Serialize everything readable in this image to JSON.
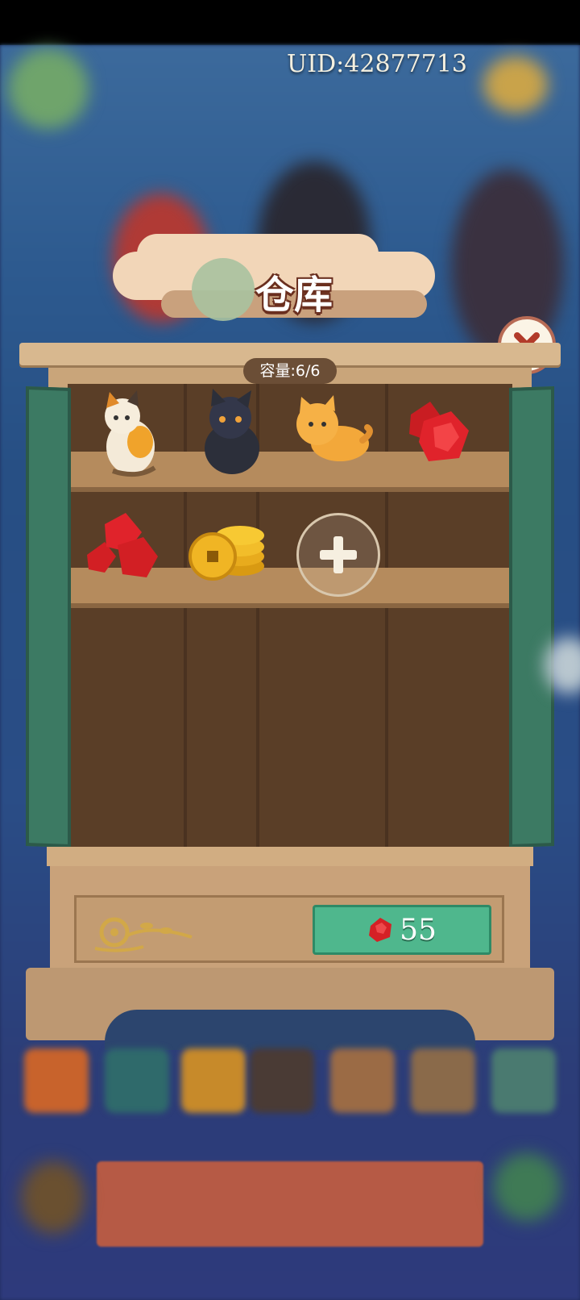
{
  "uid": "UID:42877713",
  "title": "仓库",
  "capacity": "容量:6/6",
  "items": [
    {
      "name": "calico-cat",
      "icon": "calico-cat-icon"
    },
    {
      "name": "black-cat",
      "icon": "black-cat-icon"
    },
    {
      "name": "orange-kitten",
      "icon": "orange-kitten-icon"
    },
    {
      "name": "red-gems",
      "icon": "red-gems-icon"
    },
    {
      "name": "red-gems",
      "icon": "red-gems-icon"
    },
    {
      "name": "gold-coins",
      "icon": "gold-coins-icon"
    }
  ],
  "add_slot": {
    "icon": "plus-icon"
  },
  "buy": {
    "price": "55",
    "icon": "red-gem-icon"
  },
  "colors": {
    "accent_green": "#4fb78d",
    "door_green": "#3c7a63",
    "wood": "#c9a57a",
    "close_red": "#b23b2a"
  }
}
